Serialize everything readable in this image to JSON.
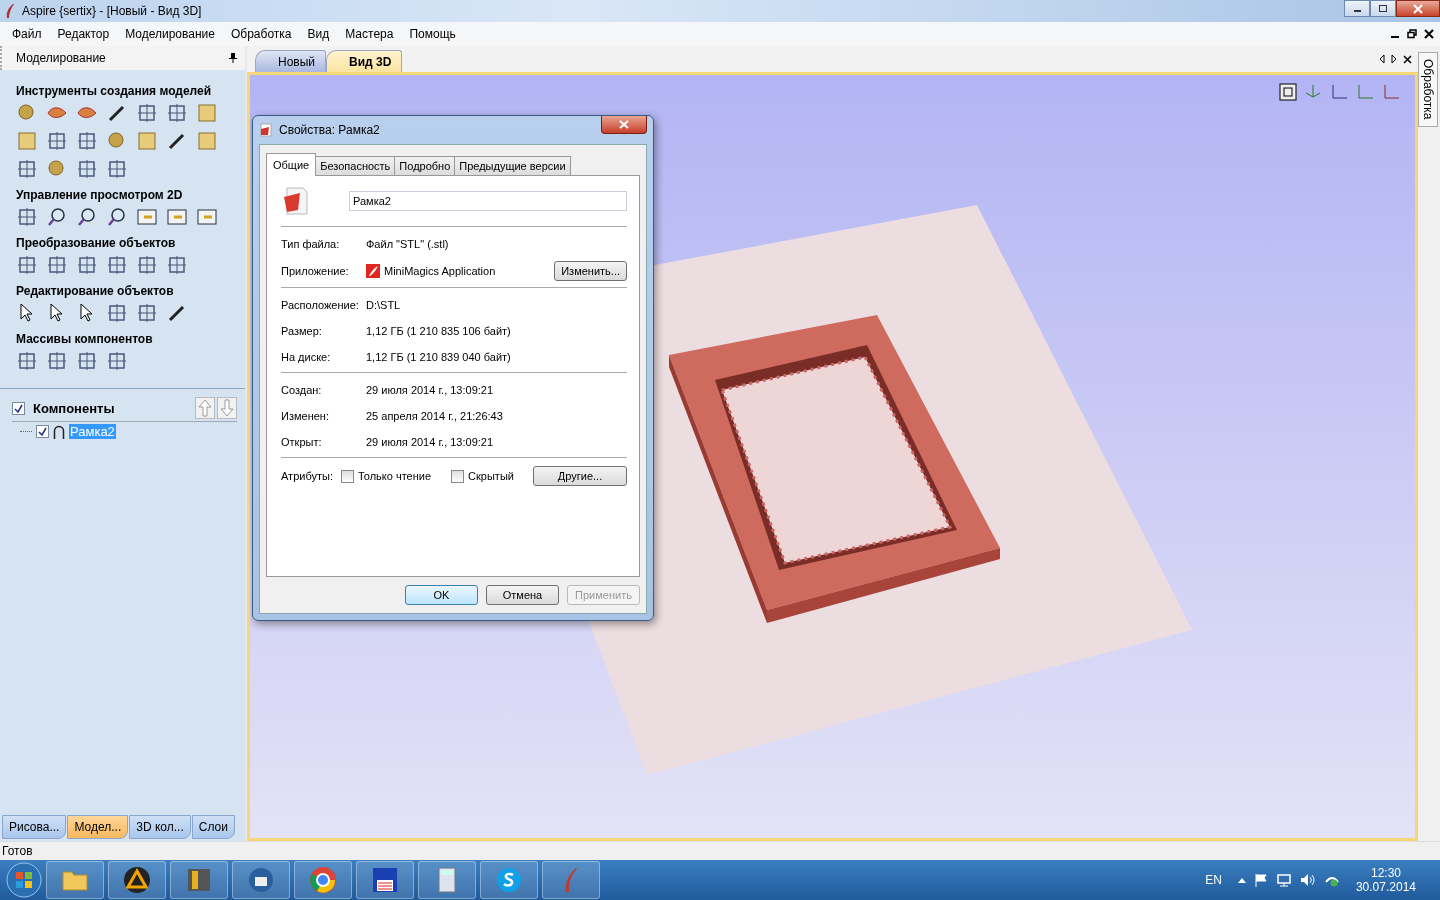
{
  "window": {
    "title": "Aspire {sertix} - [Новый - Вид 3D]"
  },
  "menu": [
    "Файл",
    "Редактор",
    "Моделирование",
    "Обработка",
    "Вид",
    "Мастера",
    "Помощь"
  ],
  "left_panel": {
    "title": "Моделирование",
    "sections": [
      {
        "title": "Инструменты создания моделей"
      },
      {
        "title": "Управление просмотром 2D"
      },
      {
        "title": "Преобразование объектов"
      },
      {
        "title": "Редактирование объектов"
      },
      {
        "title": "Массивы компонентов"
      }
    ],
    "components": {
      "title": "Компоненты",
      "checked": true,
      "items": [
        {
          "label": "Рамка2",
          "checked": true,
          "selected": true
        }
      ]
    },
    "tabs": [
      {
        "label": "Рисова...",
        "selected": false
      },
      {
        "label": "Модел...",
        "selected": true
      },
      {
        "label": "3D кол...",
        "selected": false
      },
      {
        "label": "Слои",
        "selected": false
      }
    ]
  },
  "doc_tabs": [
    {
      "label": "Новый",
      "selected": false
    },
    {
      "label": "Вид 3D",
      "selected": true
    }
  ],
  "side_tab": {
    "label": "Обработка"
  },
  "dialog": {
    "title": "Свойства: Рамка2",
    "tabs": [
      {
        "label": "Общие",
        "selected": true
      },
      {
        "label": "Безопасность",
        "selected": false
      },
      {
        "label": "Подробно",
        "selected": false
      },
      {
        "label": "Предыдущие версии",
        "selected": false
      }
    ],
    "name_value": "Рамка2",
    "groups": [
      [
        {
          "kind": "text",
          "label": "Тип файла:",
          "value": "Файл \"STL\" (.stl)"
        },
        {
          "kind": "app",
          "label": "Приложение:",
          "value": "MiniMagics Application",
          "button": "Изменить..."
        }
      ],
      [
        {
          "kind": "text",
          "label": "Расположение:",
          "value": "D:\\STL"
        },
        {
          "kind": "text",
          "label": "Размер:",
          "value": "1,12 ГБ (1 210 835 106 байт)"
        },
        {
          "kind": "text",
          "label": "На диске:",
          "value": "1,12 ГБ (1 210 839 040 байт)"
        }
      ],
      [
        {
          "kind": "text",
          "label": "Создан:",
          "value": "29 июля 2014 г., 13:09:21"
        },
        {
          "kind": "text",
          "label": "Изменен:",
          "value": "25 апреля 2014 г., 21:26:43"
        },
        {
          "kind": "text",
          "label": "Открыт:",
          "value": "29 июля 2014 г., 13:09:21"
        }
      ]
    ],
    "attributes": {
      "label": "Атрибуты:",
      "options": [
        {
          "label": "Только чтение",
          "checked": false
        },
        {
          "label": "Скрытый",
          "checked": false
        }
      ],
      "button": "Другие..."
    },
    "buttons": [
      {
        "label": "OK",
        "default": true,
        "disabled": false
      },
      {
        "label": "Отмена",
        "default": false,
        "disabled": false
      },
      {
        "label": "Применить",
        "default": false,
        "disabled": true
      }
    ]
  },
  "status_bar": "Готов",
  "tray": {
    "language": "EN",
    "time": "12:30",
    "date": "30.07.2014"
  }
}
